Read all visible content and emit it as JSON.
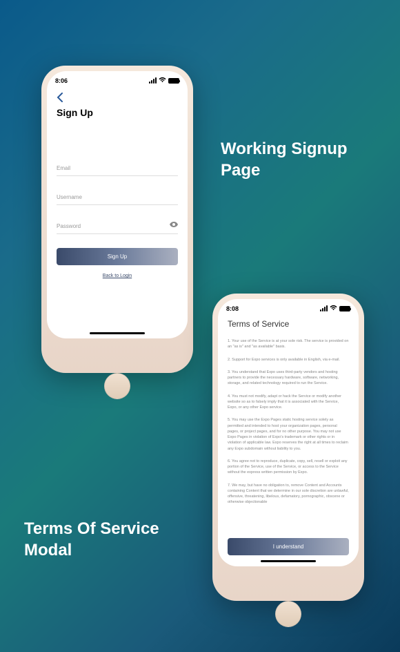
{
  "annotations": {
    "signup": "Working Signup\nPage",
    "tos": "Terms Of Service\nModal"
  },
  "phone1": {
    "time": "8:06",
    "title": "Sign Up",
    "fields": {
      "email": "Email",
      "username": "Username",
      "password": "Password"
    },
    "signup_btn": "Sign Up",
    "back_link": "Back to Login"
  },
  "phone2": {
    "time": "8:08",
    "title": "Terms of Service",
    "terms": [
      "1. Your use of the Service is at your sole risk. The service is provided on an \"as is\" and \"as available\" basis.",
      "2. Support for Expo services is only available in English, via e-mail.",
      "3. You understand that Expo uses third-party vendors and hosting partners to provide the necessary hardware, software, networking, storage, and related technology required to run the Service.",
      "4. You must not modify, adapt or hack the Service or modify another website so as to falsely imply that it is associated with the Service, Expo, or any other Expo service.",
      "5. You may use the Expo Pages static hosting service solely as permitted and intended to host your organization pages, personal pages, or project pages, and for no other purpose. You may not use Expo Pages in violation of Expo's trademark or other rights or in violation of applicable law. Expo reserves the right at all times to reclaim any Expo subdomain without liability to you.",
      "6. You agree not to reproduce, duplicate, copy, sell, resell or exploit any portion of the Service, use of the Service, or access to the Service without the express written permission by Expo.",
      "7. We may, but have no obligation to, remove Content and Accounts containing Content that we determine in our sole discretion are unlawful, offensive, threatening, libelous, defamatory, pornographic, obscene or otherwise objectionable"
    ],
    "understand_btn": "I understand"
  }
}
